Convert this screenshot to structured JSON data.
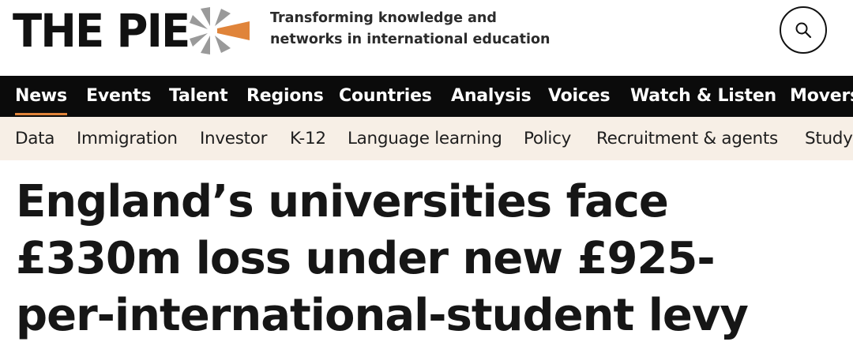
{
  "header": {
    "logo_text": "THE PIE",
    "tagline_line1": "Transforming knowledge and",
    "tagline_line2": "networks in international education",
    "brand_colors": {
      "orange": "#e0843a",
      "grey": "#9a9a9a",
      "dark": "#111111"
    }
  },
  "search": {
    "icon": "search-icon"
  },
  "nav": {
    "items": [
      {
        "label": "News",
        "active": true
      },
      {
        "label": "Events"
      },
      {
        "label": "Talent"
      },
      {
        "label": "Regions"
      },
      {
        "label": "Countries"
      },
      {
        "label": "Analysis"
      },
      {
        "label": "Voices"
      },
      {
        "label": "Watch & Listen"
      },
      {
        "label": "Movers"
      }
    ]
  },
  "subnav": {
    "items": [
      {
        "label": "Data"
      },
      {
        "label": "Immigration"
      },
      {
        "label": "Investor"
      },
      {
        "label": "K-12"
      },
      {
        "label": "Language learning"
      },
      {
        "label": "Policy"
      },
      {
        "label": "Recruitment & agents"
      },
      {
        "label": "Study"
      }
    ]
  },
  "article": {
    "headline_line1": "England’s universities face",
    "headline_line2": "£330m loss under new £925-",
    "headline_line3": "per-international-student levy"
  }
}
